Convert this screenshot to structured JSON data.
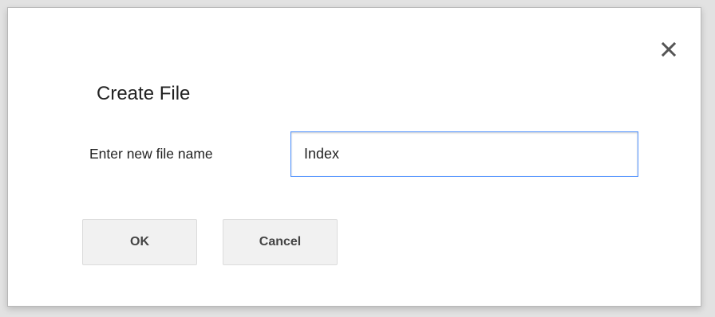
{
  "dialog": {
    "title": "Create File",
    "close_icon": "close-icon",
    "field_label": "Enter new file name",
    "file_name_value": "Index",
    "ok_label": "OK",
    "cancel_label": "Cancel"
  },
  "colors": {
    "input_focus_border": "#4d90fe",
    "button_bg": "#f1f1f1",
    "text": "#222222"
  }
}
